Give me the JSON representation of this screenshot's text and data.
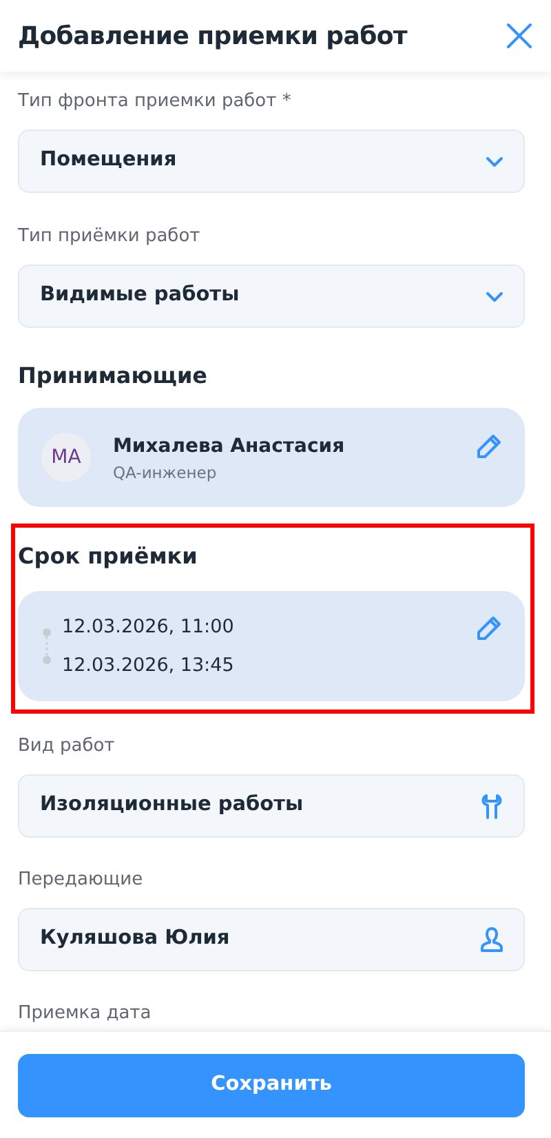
{
  "header": {
    "title": "Добавление приемки работ"
  },
  "sections": [
    {
      "kind": "select",
      "label": "Тип фронта приемки работ *",
      "value": "Помещения"
    },
    {
      "kind": "select",
      "label": "Тип приёмки работ",
      "value": "Видимые работы"
    },
    {
      "kind": "people",
      "heading": "Принимающие",
      "person": {
        "initials": "МА",
        "name": "Михалева Анастасия",
        "role": "QA-инженер"
      }
    },
    {
      "kind": "period",
      "heading": "Срок приёмки",
      "highlighted": true,
      "start": "12.03.2026, 11:00",
      "end": "12.03.2026, 13:45"
    },
    {
      "kind": "work-type",
      "label": "Вид работ",
      "value": "Изоляционные работы"
    },
    {
      "kind": "person-field",
      "label": "Передающие",
      "value": "Куляшова Юлия"
    },
    {
      "kind": "label-only",
      "label": "Приемка дата"
    }
  ],
  "footer": {
    "button": "Сохранить"
  }
}
